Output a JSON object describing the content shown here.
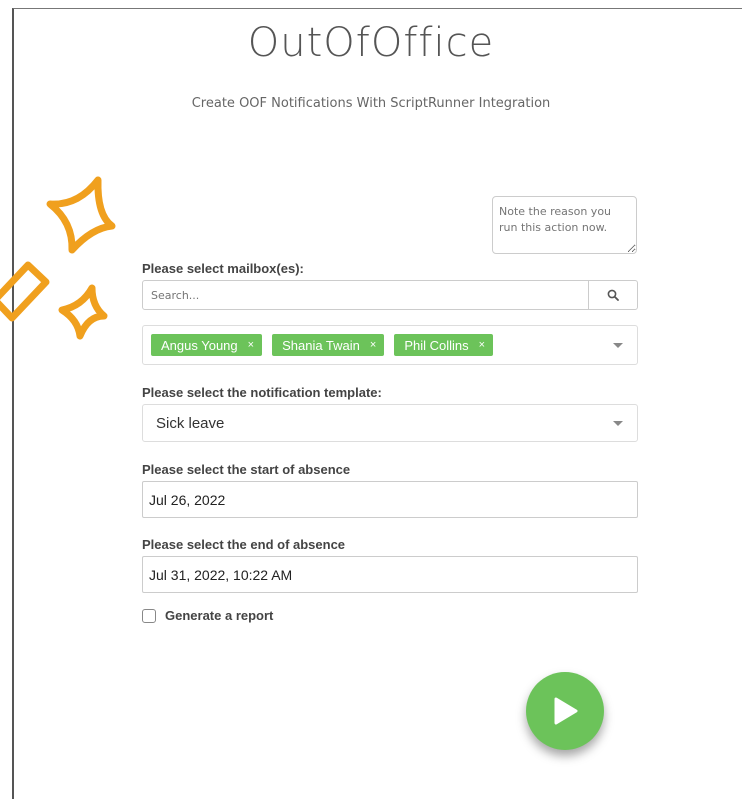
{
  "header": {
    "title": "OutOfOffice",
    "subtitle": "Create OOF Notifications With ScriptRunner Integration"
  },
  "note": {
    "placeholder": "Note the reason you run this action now."
  },
  "mailbox": {
    "label": "Please select mailbox(es):",
    "search_placeholder": "Search...",
    "selected": [
      {
        "name": "Angus Young",
        "remove": "×"
      },
      {
        "name": "Shania Twain",
        "remove": "×"
      },
      {
        "name": "Phil Collins",
        "remove": "×"
      }
    ]
  },
  "template": {
    "label": "Please select the notification template:",
    "value": "Sick leave"
  },
  "start": {
    "label": "Please select the start of absence",
    "value": "Jul 26, 2022"
  },
  "end": {
    "label": "Please select the end of absence",
    "value": "Jul 31, 2022, 10:22 AM"
  },
  "report": {
    "label": "Generate a report",
    "checked": false
  },
  "colors": {
    "accent": "#6cc35a",
    "sparkle": "#f0a01e"
  }
}
